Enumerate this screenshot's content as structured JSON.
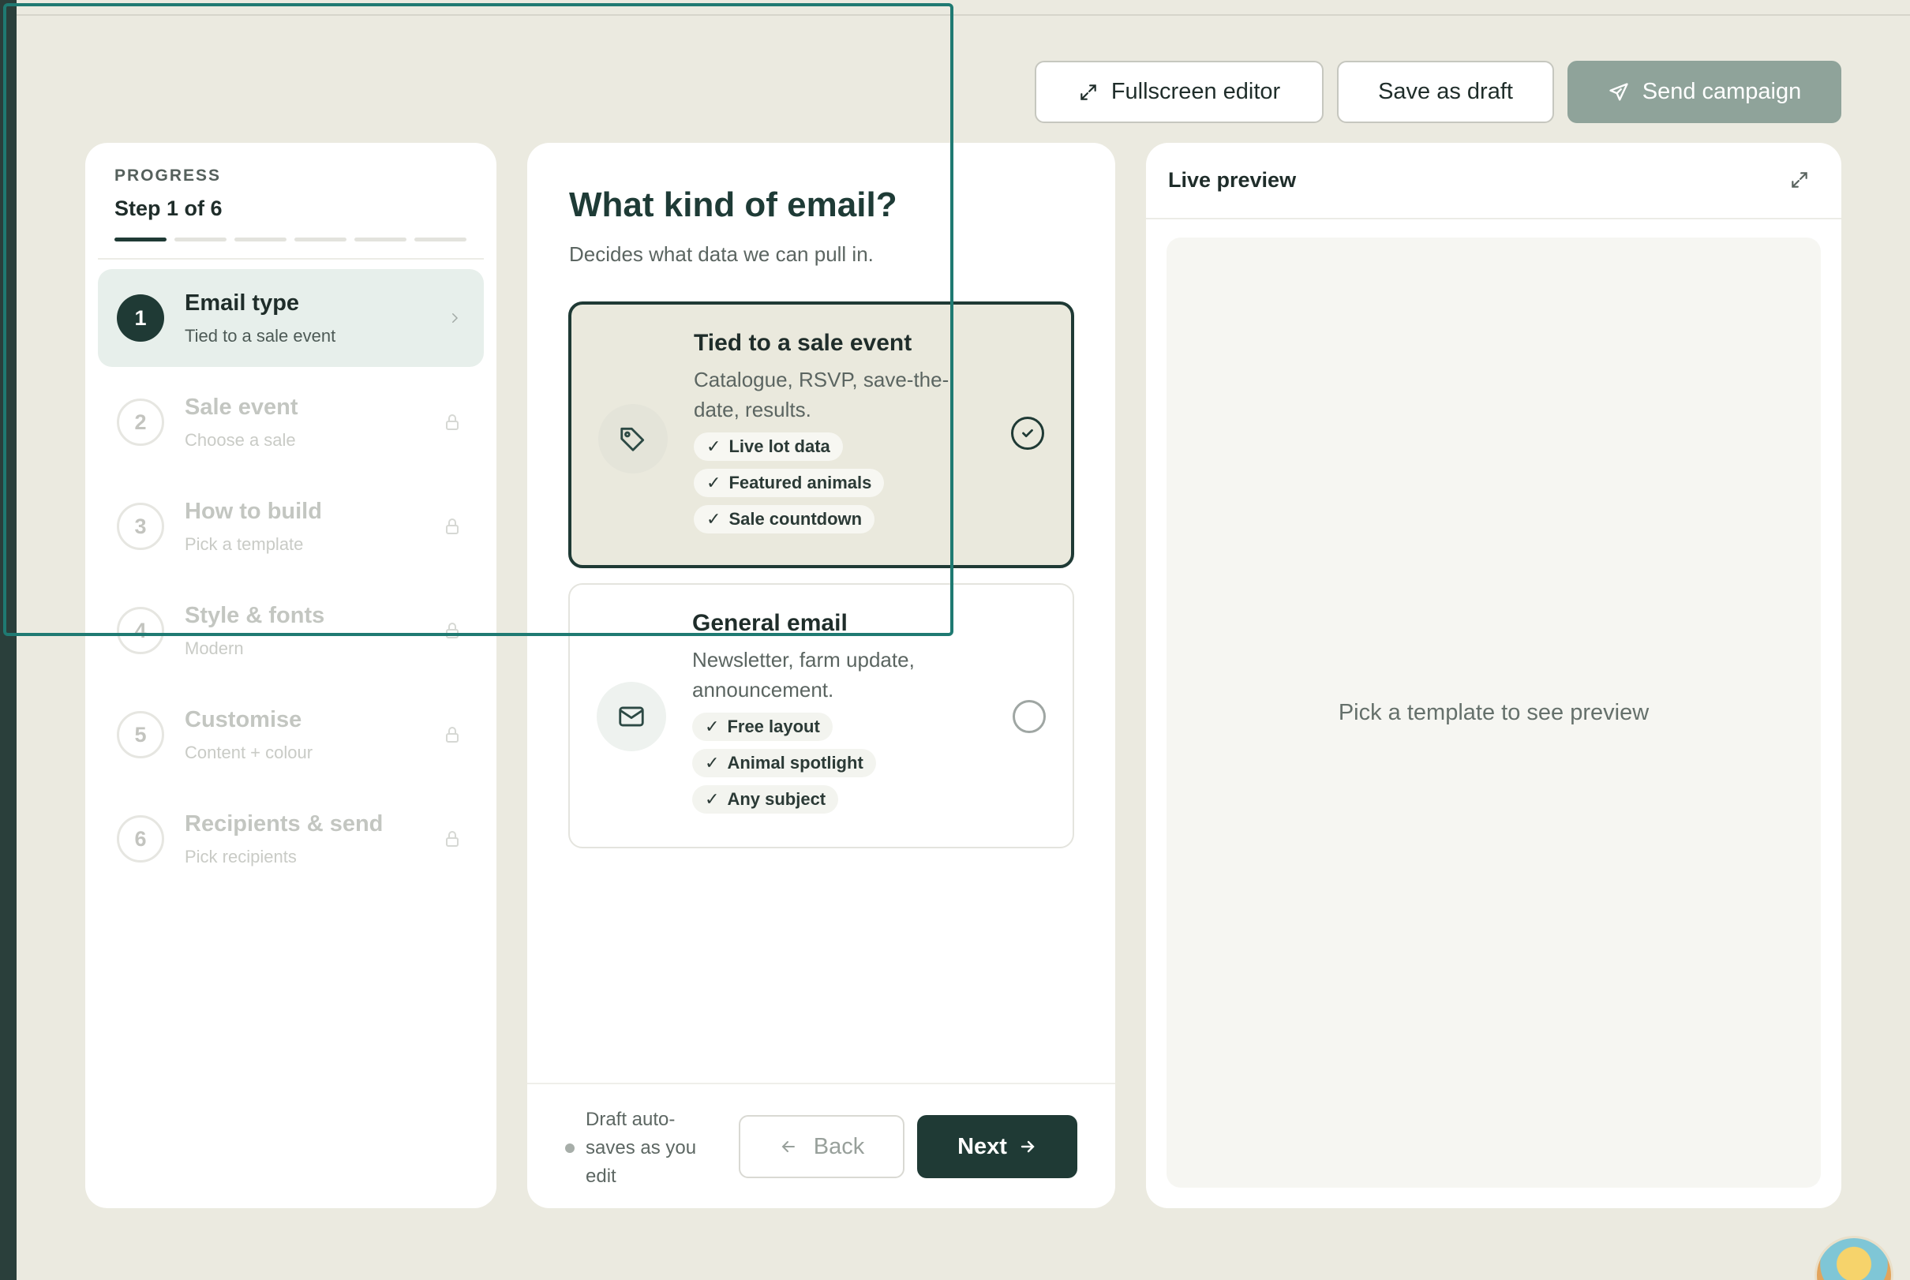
{
  "toolbar": {
    "fullscreen_label": "Fullscreen editor",
    "draft_label": "Save as draft",
    "send_label": "Send campaign"
  },
  "progress": {
    "label": "PROGRESS",
    "step_text": "Step 1 of 6",
    "current": 1,
    "total": 6,
    "steps": [
      {
        "num": "1",
        "title": "Email type",
        "sub": "Tied to a sale event"
      },
      {
        "num": "2",
        "title": "Sale event",
        "sub": "Choose a sale"
      },
      {
        "num": "3",
        "title": "How to build",
        "sub": "Pick a template"
      },
      {
        "num": "4",
        "title": "Style & fonts",
        "sub": "Modern"
      },
      {
        "num": "5",
        "title": "Customise",
        "sub": "Content + colour"
      },
      {
        "num": "6",
        "title": "Recipients & send",
        "sub": "Pick recipients"
      }
    ]
  },
  "main": {
    "title": "What kind of email?",
    "subtitle": "Decides what data we can pull in.",
    "options": [
      {
        "title": "Tied to a sale event",
        "desc": "Catalogue, RSVP, save-the-date, results.",
        "chips": [
          "Live lot data",
          "Featured animals",
          "Sale countdown"
        ],
        "selected": true
      },
      {
        "title": "General email",
        "desc": "Newsletter, farm update, announcement.",
        "chips": [
          "Free layout",
          "Animal spotlight",
          "Any subject"
        ],
        "selected": false
      }
    ],
    "autosave": "Draft auto-saves as you edit",
    "back_label": "Back",
    "next_label": "Next"
  },
  "preview": {
    "title": "Live preview",
    "empty_text": "Pick a template to see preview"
  },
  "colors": {
    "accent": "#1f3a35",
    "background": "#ebeae0",
    "send_button": "#8fa39a"
  }
}
